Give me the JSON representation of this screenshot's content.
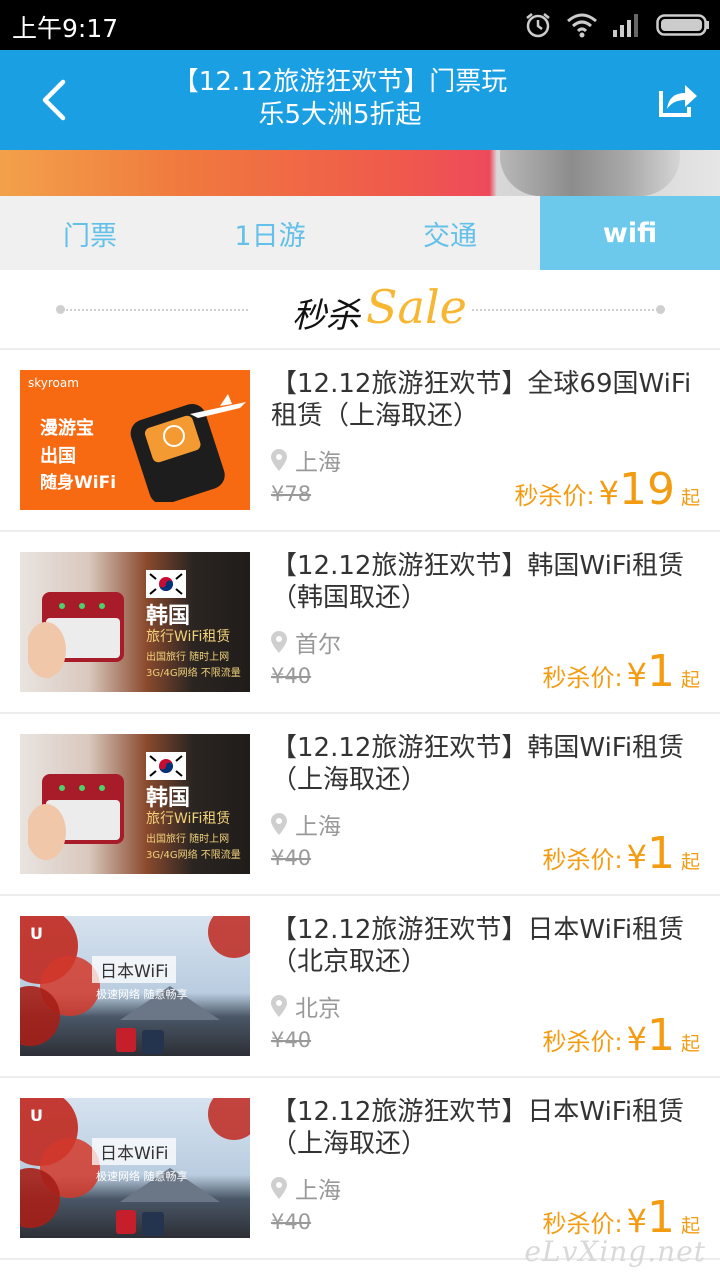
{
  "status_bar": {
    "time": "上午9:17"
  },
  "header": {
    "title_line1": "【12.12旅游狂欢节】门票玩",
    "title_line2": "乐5大洲5折起"
  },
  "tabs": [
    {
      "label": "门票",
      "active": false
    },
    {
      "label": "1日游",
      "active": false
    },
    {
      "label": "交通",
      "active": false
    },
    {
      "label": "wifi",
      "active": true
    }
  ],
  "sale_header": {
    "title": "秒杀",
    "script": "Sale"
  },
  "products": [
    {
      "title": "【12.12旅游狂欢节】全球69国WiFi租赁（上海取还）",
      "location": "上海",
      "original_price": "¥78",
      "price_label": "秒杀价:",
      "currency": "¥",
      "price": "19",
      "price_suffix": "起",
      "thumb": {
        "brand": "skyroam",
        "line1": "漫游宝",
        "line2": "出国",
        "line3": "随身WiFi"
      }
    },
    {
      "title": "【12.12旅游狂欢节】韩国WiFi租赁（韩国取还）",
      "location": "首尔",
      "original_price": "¥40",
      "price_label": "秒杀价:",
      "currency": "¥",
      "price": "1",
      "price_suffix": "起",
      "thumb": {
        "line1": "韩国",
        "line2": "旅行WiFi租赁",
        "line3": "出国旅行 随时上网",
        "line4": "3G/4G网络 不限流量"
      }
    },
    {
      "title": "【12.12旅游狂欢节】韩国WiFi租赁（上海取还）",
      "location": "上海",
      "original_price": "¥40",
      "price_label": "秒杀价:",
      "currency": "¥",
      "price": "1",
      "price_suffix": "起",
      "thumb": {
        "line1": "韩国",
        "line2": "旅行WiFi租赁",
        "line3": "出国旅行 随时上网",
        "line4": "3G/4G网络 不限流量"
      }
    },
    {
      "title": "【12.12旅游狂欢节】日本WiFi租赁（北京取还）",
      "location": "北京",
      "original_price": "¥40",
      "price_label": "秒杀价:",
      "currency": "¥",
      "price": "1",
      "price_suffix": "起",
      "thumb": {
        "line1": "日本WiFi",
        "line2": "极速网络 随意畅享"
      }
    },
    {
      "title": "【12.12旅游狂欢节】日本WiFi租赁（上海取还）",
      "location": "上海",
      "original_price": "¥40",
      "price_label": "秒杀价:",
      "currency": "¥",
      "price": "1",
      "price_suffix": "起",
      "thumb": {
        "line1": "日本WiFi",
        "line2": "极速网络 随意畅享"
      }
    }
  ],
  "watermark": "eLvXing.net",
  "colors": {
    "header_bg": "#1b9fe3",
    "tab_active_bg": "#6cc9ec",
    "price": "#f39c12",
    "sale_script": "#f7b733"
  }
}
